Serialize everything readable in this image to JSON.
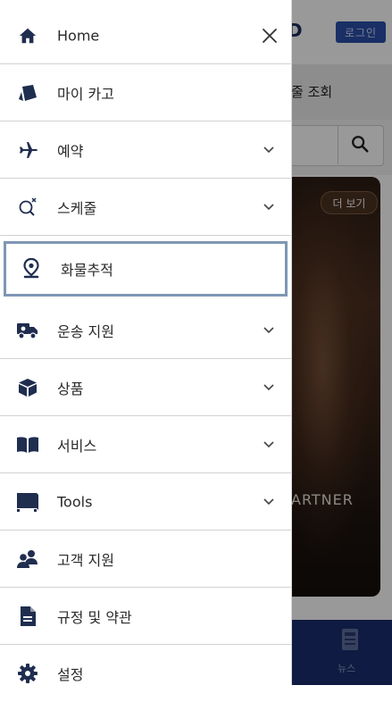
{
  "header": {
    "login_label": "로그인"
  },
  "background": {
    "tab_text": "줄 조회",
    "more_label": "더 보기",
    "banner_text": "ARTNER",
    "bottom_nav_news": "뉴스"
  },
  "menu": {
    "items": [
      {
        "label": "Home",
        "icon": "home-icon",
        "control": "close"
      },
      {
        "label": "마이 카고",
        "icon": "cargo-box-icon",
        "control": "none"
      },
      {
        "label": "예약",
        "icon": "airplane-icon",
        "control": "chevron"
      },
      {
        "label": "스케줄",
        "icon": "schedule-search-icon",
        "control": "chevron"
      },
      {
        "label": "화물추적",
        "icon": "location-pin-icon",
        "control": "none",
        "active": true
      },
      {
        "label": "운송 지원",
        "icon": "truck-icon",
        "control": "chevron"
      },
      {
        "label": "상품",
        "icon": "package-icon",
        "control": "chevron"
      },
      {
        "label": "서비스",
        "icon": "book-icon",
        "control": "chevron"
      },
      {
        "label": "Tools",
        "icon": "tools-icon",
        "control": "chevron"
      },
      {
        "label": "고객 지원",
        "icon": "users-icon",
        "control": "none"
      },
      {
        "label": "규정 및 약관",
        "icon": "document-icon",
        "control": "none"
      },
      {
        "label": "설정",
        "icon": "gear-icon",
        "control": "none"
      }
    ]
  },
  "colors": {
    "icon": "#1f2d4f",
    "active_border": "#7f96b4",
    "login_bg": "#2b4fa8",
    "bottom_nav_bg": "#1a2d6e"
  }
}
